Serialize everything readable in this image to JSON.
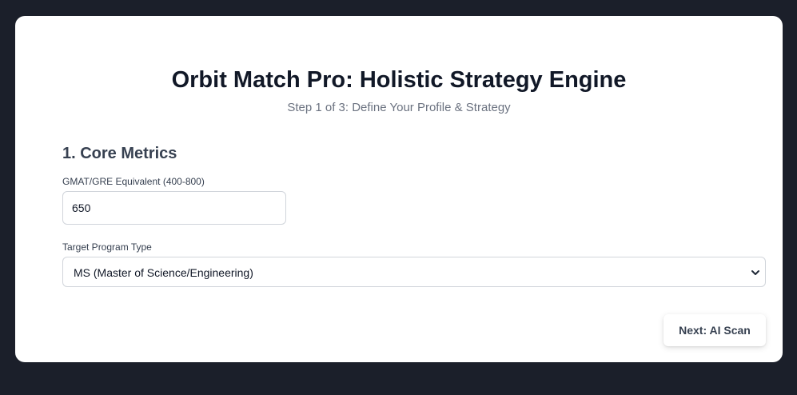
{
  "header": {
    "title": "Orbit Match Pro: Holistic Strategy Engine",
    "subtitle": "Step 1 of 3: Define Your Profile & Strategy"
  },
  "section": {
    "heading": "1. Core Metrics"
  },
  "fields": {
    "score": {
      "label": "GMAT/GRE Equivalent (400-800)",
      "value": "650"
    },
    "program": {
      "label": "Target Program Type",
      "selected": "MS (Master of Science/Engineering)"
    }
  },
  "actions": {
    "next_label": "Next: AI Scan"
  },
  "icons": {
    "dropdown": "chevron-down-icon"
  },
  "colors": {
    "page_background": "#1b1f2a",
    "card_background": "#ffffff",
    "title_text": "#111827",
    "muted_text": "#6b7280",
    "border": "#d1d5db"
  }
}
